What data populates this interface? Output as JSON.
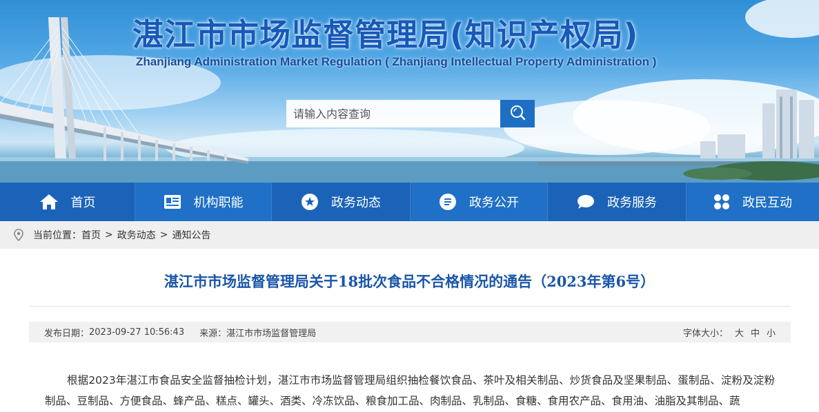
{
  "header": {
    "title": "湛江市市场监督管理局(知识产权局)",
    "subtitle": "Zhanjiang Administration Market Regulation ( Zhanjiang Intellectual Property Administration )",
    "search": {
      "placeholder": "请输入内容查询",
      "icon": "search-icon"
    }
  },
  "nav": {
    "items": [
      {
        "label": "首页",
        "icon": "home-icon"
      },
      {
        "label": "机构职能",
        "icon": "id-card-icon"
      },
      {
        "label": "政务动态",
        "icon": "star-icon"
      },
      {
        "label": "政务公开",
        "icon": "list-icon"
      },
      {
        "label": "政务服务",
        "icon": "chat-icon"
      },
      {
        "label": "政民互动",
        "icon": "grid-icon"
      }
    ],
    "colors": {
      "bar": "#1a63b8",
      "alt": "#1f70c6"
    }
  },
  "breadcrumb": {
    "prefix": "当前位置：",
    "items": [
      "首页",
      "政务动态",
      "通知公告"
    ],
    "separator": ">",
    "icon": "location-pin-icon"
  },
  "article": {
    "title": "湛江市市场监督管理局关于18批次食品不合格情况的通告（2023年第6号）",
    "meta": {
      "date_label": "发布日期：",
      "date_value": "2023-09-27 10:56:43",
      "source_label": "来源：",
      "source_value": "湛江市市场监督管理局",
      "font_label": "字体大小：",
      "font_sizes": [
        "大",
        "中",
        "小"
      ]
    },
    "body": "根据2023年湛江市食品安全监督抽检计划，湛江市市场监督管理局组织抽检餐饮食品、茶叶及相关制品、炒货食品及坚果制品、蛋制品、淀粉及淀粉制品、豆制品、方便食品、蜂产品、糕点、罐头、酒类、冷冻饮品、粮食加工品、肉制品、乳制品、食糖、食用农产品、食用油、油脂及其制品、蔬"
  },
  "colors": {
    "title_blue": "#1659b8",
    "article_title": "#1a56a8",
    "search_button": "#1e6fc4"
  }
}
